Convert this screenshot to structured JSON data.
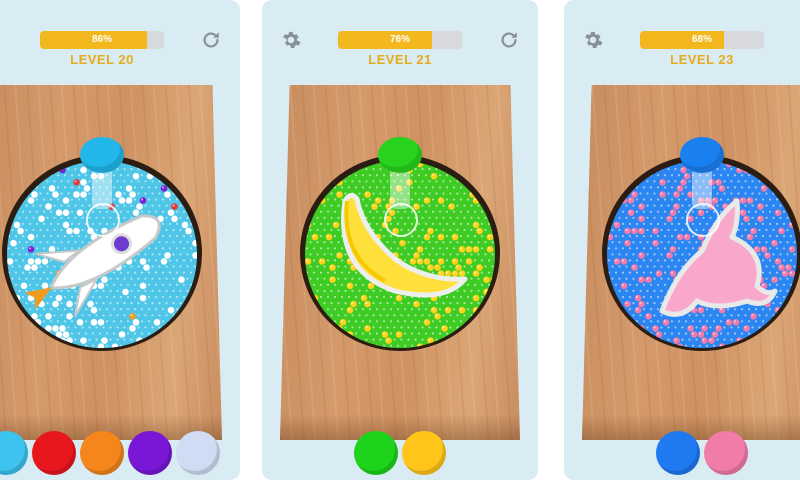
{
  "screens": [
    {
      "progress_text": "86%",
      "progress": 0.86,
      "level_label": "LEVEL 20",
      "show_gear": false,
      "show_restart": true,
      "shape": "rocket",
      "pit_colors": [
        "#4fc6e8",
        "#ffffff",
        "#e53935",
        "#7e1fd6",
        "#f29b1d"
      ],
      "pusher_color": "#22b7ea",
      "swatches": [
        "#3cc4ee",
        "#e8171e",
        "#f4861b",
        "#7a17d6",
        "#cfdcf3"
      ]
    },
    {
      "progress_text": "76%",
      "progress": 0.76,
      "level_label": "LEVEL 21",
      "show_gear": true,
      "show_restart": true,
      "shape": "banana",
      "pit_colors": [
        "#3ecb24",
        "#ffd21a"
      ],
      "pusher_color": "#27d31c",
      "swatches": [
        "#1ed31b",
        "#ffc51a"
      ]
    },
    {
      "progress_text": "68%",
      "progress": 0.68,
      "level_label": "LEVEL 23",
      "show_gear": true,
      "show_restart": false,
      "shape": "dolphin",
      "pit_colors": [
        "#2b86f2",
        "#f37aa9"
      ],
      "pusher_color": "#1b80ef",
      "swatches": [
        "#1f7af2",
        "#f27ca8"
      ]
    }
  ]
}
